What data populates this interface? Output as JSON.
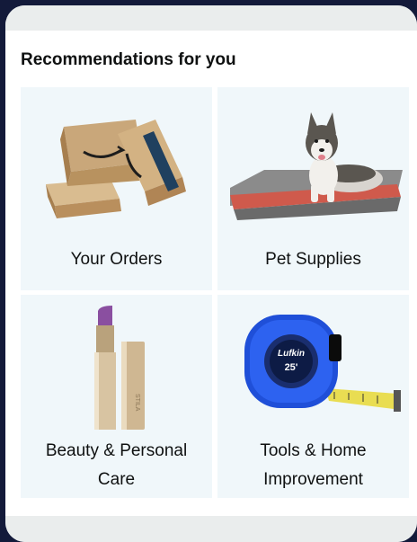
{
  "section": {
    "title": "Recommendations for you",
    "tiles": [
      {
        "label": "Your Orders",
        "icon": "amazon-boxes-image"
      },
      {
        "label": "Pet Supplies",
        "icon": "husky-dog-bed-image"
      },
      {
        "label": "Beauty & Personal Care",
        "icon": "lipstick-image"
      },
      {
        "label": "Tools & Home Improvement",
        "icon": "tape-measure-image"
      }
    ],
    "tape_measure": {
      "brand": "Lufkin",
      "size": "25'"
    },
    "lipstick_brand": "STILA"
  },
  "colors": {
    "page_background": "#131a3a",
    "tile_background": "#f0f7fa",
    "text": "#0f1111",
    "cardboard": "#c9a77a",
    "tape_blue": "#1f4fd8",
    "tape_yellow": "#e9dd52"
  }
}
